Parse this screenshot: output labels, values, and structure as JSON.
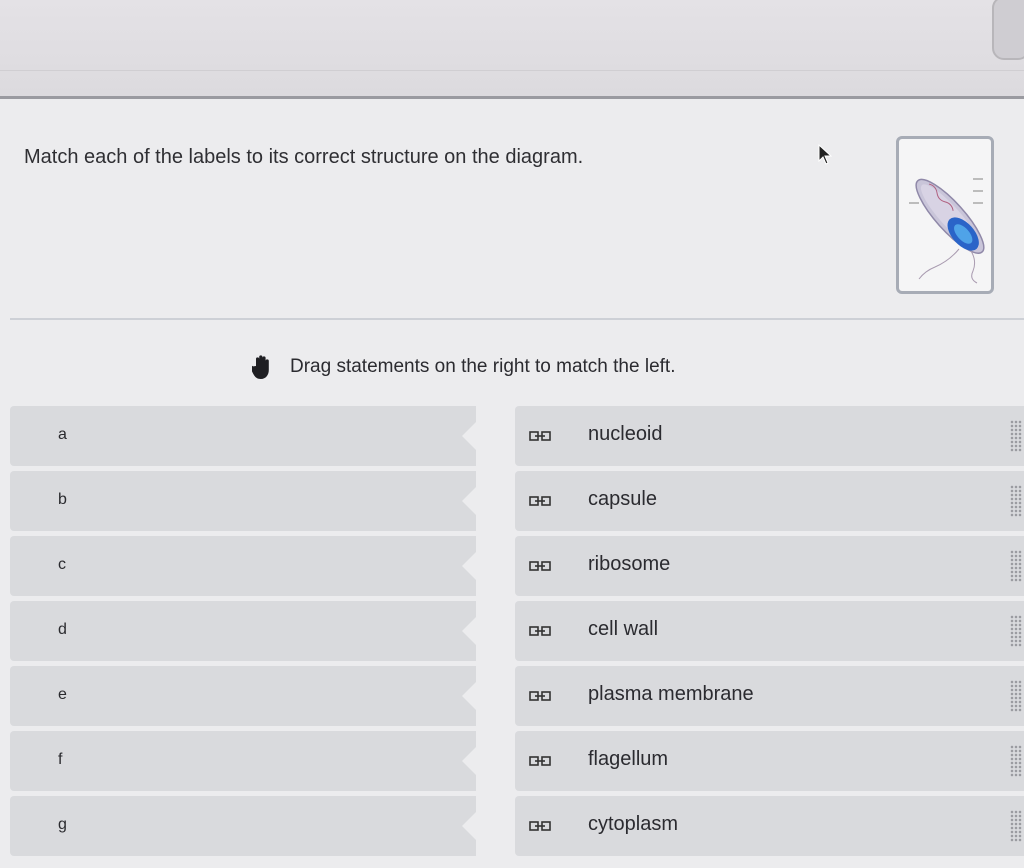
{
  "question": {
    "prompt": "Match each of the labels to its correct structure on the diagram."
  },
  "diagram": {
    "icon": "bacterium-diagram-thumbnail"
  },
  "instruction": {
    "icon": "hand-icon",
    "text": "Drag statements on the right to match the left."
  },
  "slots": [
    {
      "letter": "a"
    },
    {
      "letter": "b"
    },
    {
      "letter": "c"
    },
    {
      "letter": "d"
    },
    {
      "letter": "e"
    },
    {
      "letter": "f"
    },
    {
      "letter": "g"
    }
  ],
  "items": [
    {
      "label": "nucleoid"
    },
    {
      "label": "capsule"
    },
    {
      "label": "ribosome"
    },
    {
      "label": "cell wall"
    },
    {
      "label": "plasma membrane"
    },
    {
      "label": "flagellum"
    },
    {
      "label": "cytoplasm"
    }
  ],
  "colors": {
    "page_background": "#ececee",
    "row_background": "#d9dadd",
    "text": "#2b2b30"
  }
}
